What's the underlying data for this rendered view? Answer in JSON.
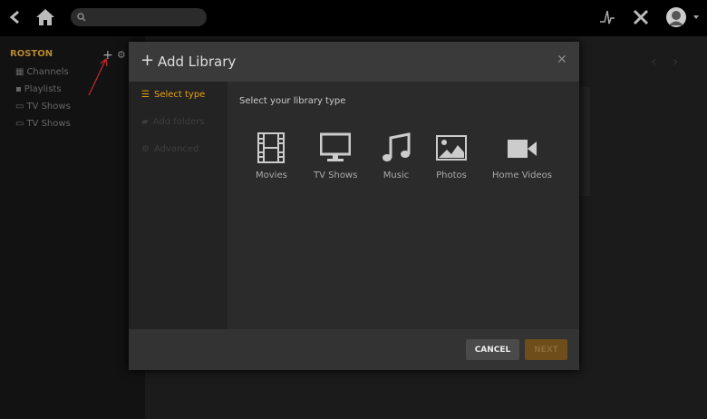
{
  "topbar": {
    "search_placeholder": ""
  },
  "sidebar": {
    "server_name": "ROSTON",
    "items": [
      {
        "label": "Channels"
      },
      {
        "label": "Playlists"
      },
      {
        "label": "TV Shows"
      },
      {
        "label": "TV Shows"
      }
    ]
  },
  "modal": {
    "title": "Add Library",
    "nav": [
      {
        "label": "Select type"
      },
      {
        "label": "Add folders"
      },
      {
        "label": "Advanced"
      }
    ],
    "prompt": "Select your library type",
    "types": [
      {
        "label": "Movies"
      },
      {
        "label": "TV Shows"
      },
      {
        "label": "Music"
      },
      {
        "label": "Photos"
      },
      {
        "label": "Home Videos"
      }
    ],
    "cancel": "CANCEL",
    "next": "NEXT"
  },
  "colors": {
    "accent": "#e5a00d"
  }
}
